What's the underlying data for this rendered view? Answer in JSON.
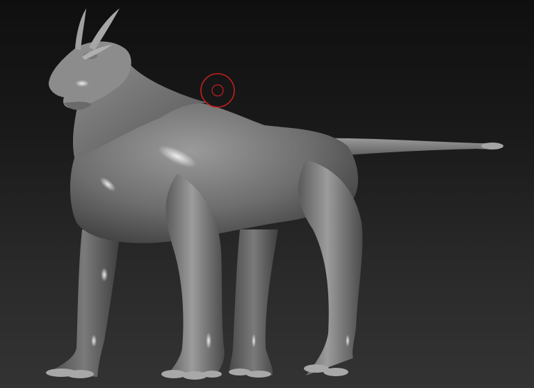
{
  "viewport": {
    "background_top": "#0f0f0f",
    "background_bottom": "#333333"
  },
  "model": {
    "subject": "quadruped-creature-sculpt",
    "material_color": "#8a8a8a",
    "highlight_color": "#e6e6e6",
    "shadow_color": "#2a2a2a"
  },
  "brush_cursor": {
    "icon": "brush-ring-icon",
    "color": "#c81e1e"
  }
}
